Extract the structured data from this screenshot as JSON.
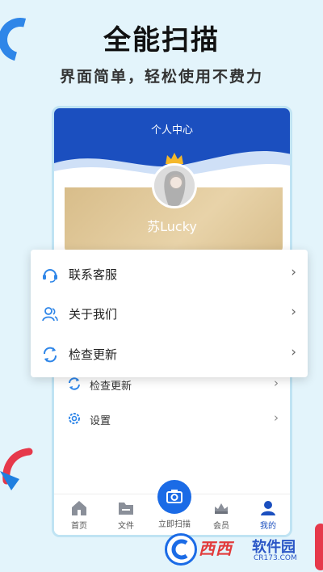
{
  "promo": {
    "title": "全能扫描",
    "subtitle": "界面简单，轻松使用不费力"
  },
  "screen": {
    "header_title": "个人中心",
    "username": "苏Lucky",
    "menu": [
      {
        "label": "检查更新",
        "icon": "refresh-icon"
      },
      {
        "label": "设置",
        "icon": "gear-icon"
      }
    ],
    "tabs": [
      {
        "label": "首页",
        "icon": "home-icon"
      },
      {
        "label": "文件",
        "icon": "folder-icon"
      },
      {
        "label": "立即扫描",
        "icon": "camera-icon"
      },
      {
        "label": "会员",
        "icon": "vip-crown-icon"
      },
      {
        "label": "我的",
        "icon": "user-icon"
      }
    ]
  },
  "overlay_menu": [
    {
      "label": "联系客服",
      "icon": "headset-icon"
    },
    {
      "label": "关于我们",
      "icon": "users-icon"
    },
    {
      "label": "检查更新",
      "icon": "refresh-icon"
    }
  ],
  "watermark": {
    "brand": "西西",
    "name": "软件园",
    "url": "CR173.COM"
  },
  "colors": {
    "primary": "#1b4fbf",
    "accent": "#2f86e8",
    "gold": "#d8bd8a",
    "background": "#e3f4fb"
  }
}
